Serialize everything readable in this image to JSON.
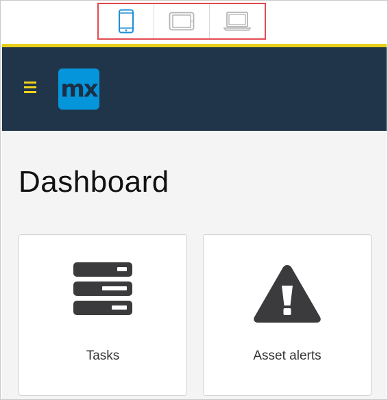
{
  "device_switcher": {
    "devices": [
      {
        "name": "Phone",
        "icon": "phone-icon",
        "active": true
      },
      {
        "name": "Tablet",
        "icon": "tablet-icon",
        "active": false
      },
      {
        "name": "Desktop",
        "icon": "laptop-icon",
        "active": false
      }
    ],
    "highlight_color": "#e24a4f",
    "active_color": "#1e8fd6",
    "inactive_color": "#b4b4b4"
  },
  "header": {
    "menu_icon": "hamburger-icon",
    "logo_text": "mx",
    "background": "#203549",
    "accent": "#e6cf1a",
    "logo_color": "#0595db"
  },
  "main": {
    "title": "Dashboard",
    "cards": [
      {
        "label": "Tasks",
        "icon": "server-icon"
      },
      {
        "label": "Asset alerts",
        "icon": "warning-icon"
      }
    ]
  }
}
